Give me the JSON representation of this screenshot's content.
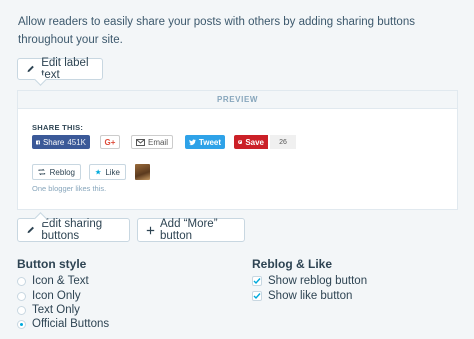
{
  "description": "Allow readers to easily share your posts with others by adding sharing buttons throughout your site.",
  "edit_label_button": "Edit label text",
  "preview": {
    "header": "PREVIEW",
    "share_label": "SHARE THIS:",
    "buttons": {
      "facebook": "Share",
      "facebook_count": "451K",
      "google_plus": "G+",
      "email": "Email",
      "twitter": "Tweet",
      "pinterest": "Save",
      "pinterest_count": "26"
    },
    "reblog": "Reblog",
    "like": "Like",
    "bloggers_text": "One blogger likes this."
  },
  "edit_sharing_button": "Edit sharing buttons",
  "add_more_button": "Add “More” button",
  "button_style": {
    "title": "Button style",
    "options": [
      "Icon & Text",
      "Icon Only",
      "Text Only",
      "Official Buttons"
    ],
    "selected": "Official Buttons"
  },
  "reblog_like": {
    "title": "Reblog & Like",
    "options": [
      "Show reblog button",
      "Show like button"
    ],
    "checked": [
      true,
      true
    ]
  },
  "colors": {
    "accent": "#00aadc",
    "facebook": "#3b5998",
    "twitter": "#2ea2e8",
    "pinterest": "#cb2027"
  }
}
